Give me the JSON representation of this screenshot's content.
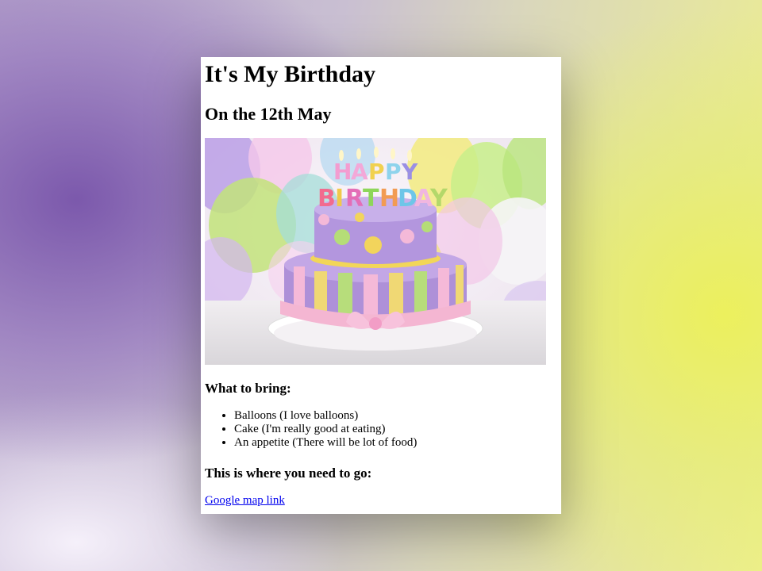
{
  "page": {
    "title": "It's My Birthday",
    "subtitle": "On the 12th May",
    "hero_image_text": "HAPPY BIRTHDAY",
    "bring_heading": "What to bring:",
    "bring_items": [
      "Balloons (I love balloons)",
      "Cake (I'm really good at eating)",
      "An appetite (There will be lot of food)"
    ],
    "directions_heading": "This is where you need to go:",
    "map_link_label": "Google map link"
  },
  "colors": {
    "background_left": "#7854aa",
    "background_right": "#ecf05a",
    "link": "#0000ee"
  }
}
